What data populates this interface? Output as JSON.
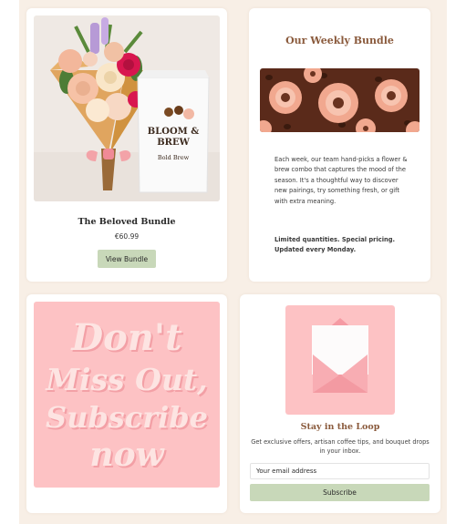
{
  "colors": {
    "page_background": "#f8efe6",
    "accent_brown": "#8a5a3c",
    "button_green": "#c8d8b9",
    "promo_pink": "#fdc2c4"
  },
  "product": {
    "name": "The Beloved Bundle",
    "price": "€60.99",
    "button_label": "View Bundle",
    "bag_brand_line1": "BLOOM &",
    "bag_brand_line2": "BREW",
    "bag_flavor": "Bold Brew"
  },
  "weekly": {
    "title": "Our Weekly Bundle",
    "description": "Each week, our team hand-picks a flower & brew combo that captures the mood of the season. It's a thoughtful way to discover new pairings, try something fresh, or gift with extra meaning.",
    "note": "Limited quantities. Special pricing. Updated every Monday."
  },
  "promo": {
    "line1": "Don't",
    "line2": "Miss Out,",
    "line3": "Subscribe",
    "line4": "now"
  },
  "subscribe": {
    "title": "Stay in the Loop",
    "description": "Get exclusive offers, artisan coffee tips, and bouquet drops in your inbox.",
    "email_placeholder": "Your email address",
    "button_label": "Subscribe",
    "envelope_icon": "envelope-icon"
  }
}
